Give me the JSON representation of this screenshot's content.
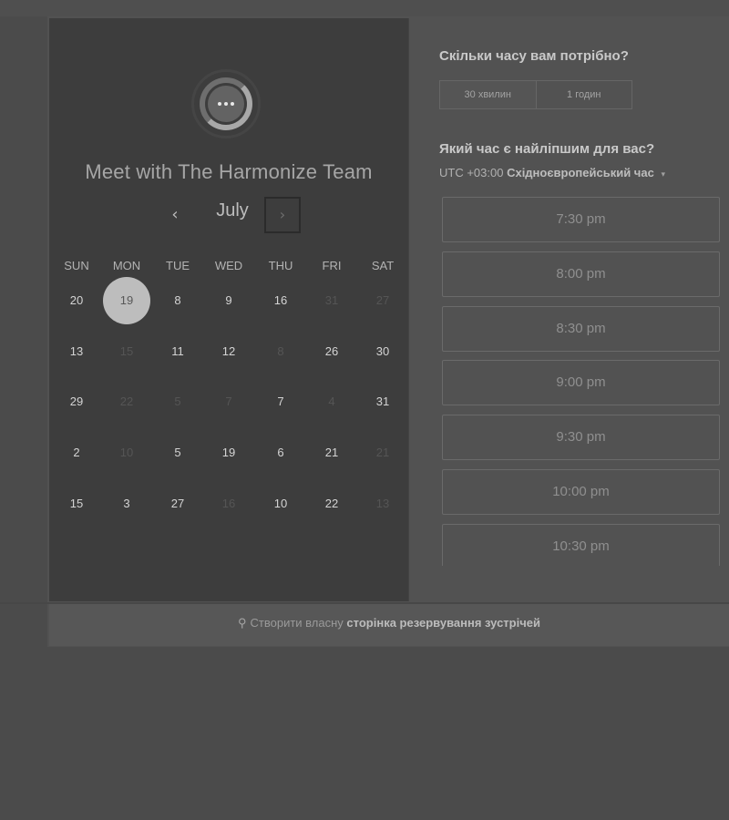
{
  "calendar": {
    "title": "Meet with The Harmonize Team",
    "month": "July",
    "prev_icon": "‹",
    "next_icon": "›",
    "weekdays": [
      "SUN",
      "MON",
      "TUE",
      "WED",
      "THU",
      "FRI",
      "SAT"
    ],
    "weeks": [
      [
        {
          "d": "20"
        },
        {
          "d": "19",
          "selected": true
        },
        {
          "d": "8"
        },
        {
          "d": "9"
        },
        {
          "d": "16"
        },
        {
          "d": "31",
          "muted": true
        },
        {
          "d": "27",
          "muted": true
        }
      ],
      [
        {
          "d": "13"
        },
        {
          "d": "15",
          "muted": true
        },
        {
          "d": "11"
        },
        {
          "d": "12"
        },
        {
          "d": "8",
          "muted": true
        },
        {
          "d": "26"
        },
        {
          "d": "30"
        }
      ],
      [
        {
          "d": "29"
        },
        {
          "d": "22",
          "muted": true
        },
        {
          "d": "5",
          "muted": true
        },
        {
          "d": "7",
          "muted": true
        },
        {
          "d": "7"
        },
        {
          "d": "4",
          "muted": true
        },
        {
          "d": "31"
        }
      ],
      [
        {
          "d": "2"
        },
        {
          "d": "10",
          "muted": true
        },
        {
          "d": "5"
        },
        {
          "d": "19"
        },
        {
          "d": "6"
        },
        {
          "d": "21"
        },
        {
          "d": "21",
          "muted": true
        }
      ],
      [
        {
          "d": "15"
        },
        {
          "d": "3"
        },
        {
          "d": "27"
        },
        {
          "d": "16",
          "muted": true
        },
        {
          "d": "10"
        },
        {
          "d": "22"
        },
        {
          "d": "13",
          "muted": true
        }
      ]
    ]
  },
  "duration": {
    "question": "Скільки часу вам потрібно?",
    "options": [
      "30 хвилин",
      "1 годин"
    ]
  },
  "time": {
    "question": "Який час є найліпшим для вас?",
    "tz_offset": "UTC +03:00",
    "tz_name": "Східноєвропейський час",
    "tz_caret": "▾",
    "slots": [
      "7:30 pm",
      "8:00 pm",
      "8:30 pm",
      "9:00 pm",
      "9:30 pm",
      "10:00 pm",
      "10:30 pm"
    ]
  },
  "footer": {
    "prefix": "Створити власну",
    "link": "сторінка резервування зустрічей"
  }
}
